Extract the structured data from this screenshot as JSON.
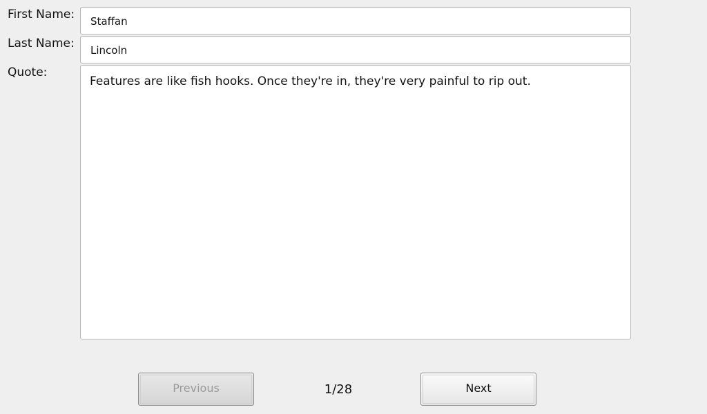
{
  "form": {
    "first_name_label": "First Name:",
    "first_name_value": "Staffan",
    "last_name_label": "Last Name:",
    "last_name_value": "Lincoln",
    "quote_label": "Quote:",
    "quote_value": "Features are like fish hooks. Once they're in, they're very painful to rip out."
  },
  "navigation": {
    "previous_label": "Previous",
    "previous_enabled": false,
    "next_label": "Next",
    "next_enabled": true,
    "page_indicator": "1/28"
  }
}
